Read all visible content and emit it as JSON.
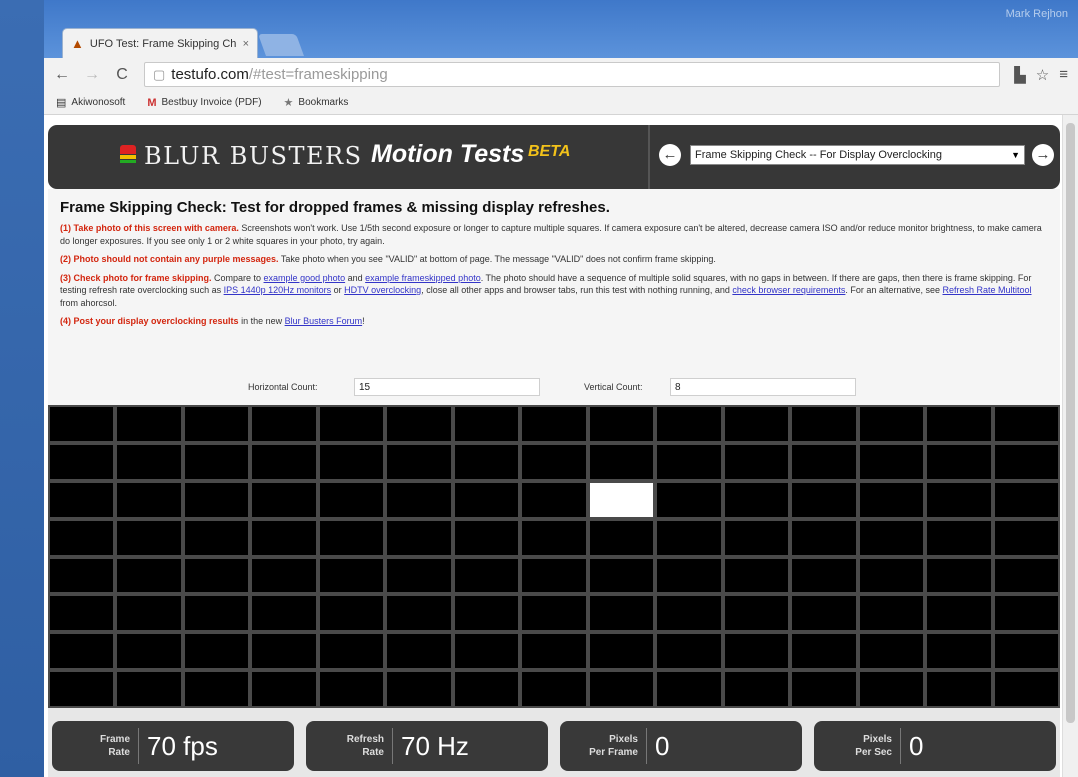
{
  "window": {
    "title": "Mark Rejhon"
  },
  "tab": {
    "title": "UFO Test: Frame Skipping Ch",
    "close": "×"
  },
  "toolbar": {
    "url_host": "testufo.com",
    "url_path": "/#test=frameskipping",
    "back": "←",
    "forward": "→",
    "reload": "C",
    "page_icon": "▢",
    "ext": "▙",
    "star": "☆",
    "menu": "≡"
  },
  "bookmarks": [
    {
      "icon": "▤",
      "label": "Akiwonosoft"
    },
    {
      "icon": "M",
      "label": "Bestbuy Invoice (PDF)"
    },
    {
      "icon": "★",
      "label": "Bookmarks"
    }
  ],
  "banner": {
    "logo_text": "BLUR BUSTERS",
    "motion_text": "Motion Tests",
    "beta": "BETA",
    "prev": "←",
    "next": "→",
    "selected_test": "Frame Skipping Check -- For Display Overclocking"
  },
  "info": {
    "heading": "Frame Skipping Check: Test for dropped frames & missing display refreshes.",
    "p1_red": "(1) Take photo of this screen with camera.",
    "p1_text": " Screenshots won't work. Use 1/5th second exposure or longer to capture multiple squares. If camera exposure can't be altered, decrease camera ISO and/or reduce monitor brightness, to make camera do longer exposures. If you see only 1 or 2 white squares in your photo, try again.",
    "p2_red": "(2) Photo should not contain any purple messages.",
    "p2_text": " Take photo when you see \"VALID\" at bottom of page. The message \"VALID\" does not confirm frame skipping.",
    "p3_red": "(3) Check photo for frame skipping.",
    "p3_t1": " Compare to ",
    "p3_l1": "example good photo",
    "p3_t2": " and ",
    "p3_l2": "example frameskipped photo",
    "p3_t3": ". The photo should have a sequence of multiple solid squares, with no gaps in between. If there are gaps, then there is frame skipping. For testing refresh rate overclocking such as ",
    "p3_l3": "IPS 1440p 120Hz monitors",
    "p3_t4": " or ",
    "p3_l4": "HDTV overclocking",
    "p3_t5": ", close all other apps and browser tabs, run this test with nothing running, and ",
    "p3_l5": "check browser requirements",
    "p3_t6": ". For an alternative, see ",
    "p3_l6": "Refresh Rate Multitool",
    "p3_t7": " from ahorcsol.",
    "p4_red": "(4) Post your display overclocking results",
    "p4_t1": " in the new ",
    "p4_l1": "Blur Busters Forum",
    "p4_t2": "!"
  },
  "counts": {
    "horizontal_label": "Horizontal Count:",
    "horizontal_value": "15",
    "vertical_label": "Vertical Count:",
    "vertical_value": "8"
  },
  "grid": {
    "columns": 15,
    "rows": 8,
    "active_row": 2,
    "active_col": 8
  },
  "stats": [
    {
      "label_line1": "Frame",
      "label_line2": "Rate",
      "value": "70 fps"
    },
    {
      "label_line1": "Refresh",
      "label_line2": "Rate",
      "value": "70 Hz"
    },
    {
      "label_line1": "Pixels",
      "label_line2": "Per Frame",
      "value": "0"
    },
    {
      "label_line1": "Pixels",
      "label_line2": "Per Sec",
      "value": "0"
    }
  ]
}
